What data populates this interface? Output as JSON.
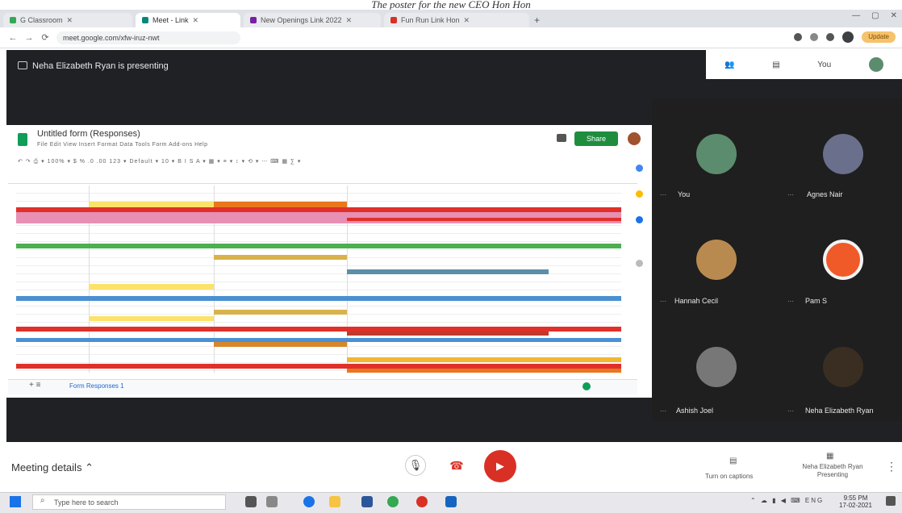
{
  "caption": "The poster for the new CEO Hon Hon",
  "browser": {
    "tabs": [
      {
        "label": "G Classroom",
        "color": "#34a853"
      },
      {
        "label": "Meet - Link",
        "color": "#00897b"
      },
      {
        "label": "New Openings Link 2022",
        "color": "#7b1fa2"
      },
      {
        "label": "Fun Run Link Hon",
        "color": "#d93025"
      }
    ],
    "new_tab": "+",
    "url": "meet.google.com/xfw-iruz-nwt",
    "update_label": "Update"
  },
  "meet": {
    "presenting": "Neha Elizabeth Ryan is presenting",
    "you_label": "You"
  },
  "sheet": {
    "title": "Untitled form (Responses)",
    "menu": "File  Edit  View  Insert  Format  Data  Tools  Form  Add-ons  Help",
    "share_label": "Share",
    "sheet_tab": "Form Responses 1"
  },
  "participants": [
    {
      "name": "You",
      "color": "#5c8c6e"
    },
    {
      "name": "Agnes Nair",
      "color": "#6a6f8c"
    },
    {
      "name": "Hannah Cecil",
      "color": "#b98a50"
    },
    {
      "name": "Pam S",
      "color": "#f05a28"
    },
    {
      "name": "Ashish Joel",
      "color": "#777777"
    },
    {
      "name": "Neha Elizabeth Ryan",
      "color": "#3a2e22"
    }
  ],
  "bottom": {
    "meeting_details": "Meeting details",
    "captions": "Turn on captions",
    "presenter": "Neha Elizabeth Ryan Presenting"
  },
  "taskbar": {
    "search_placeholder": "Type here to search",
    "time": "9:55 PM",
    "date": "17-02-2021"
  }
}
